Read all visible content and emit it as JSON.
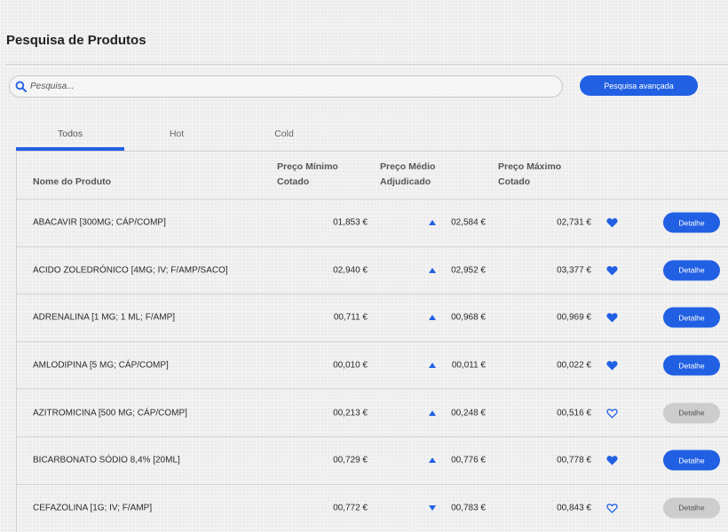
{
  "page": {
    "title": "Pesquisa de Produtos"
  },
  "search": {
    "placeholder": "Pesquisa...",
    "value": "",
    "advanced_label": "Pesquisa avançada"
  },
  "tabs": [
    {
      "label": "Todos",
      "active": true
    },
    {
      "label": "Hot",
      "active": false
    },
    {
      "label": "Cold",
      "active": false
    }
  ],
  "table": {
    "columns": {
      "name": "Nome do Produto",
      "min": "Preço Mínimo Cotado",
      "avg": "Preço Médio Adjudicado",
      "max": "Preço Máximo Cotado"
    },
    "rows": [
      {
        "name": "ABACAVIR [300MG; CÁP/COMP]",
        "min": "01,853 €",
        "trend": "up",
        "avg": "02,584 €",
        "max": "02,731 €",
        "favorite": true,
        "action": "Detalhe",
        "action_enabled": true
      },
      {
        "name": "ACIDO ZOLEDRÓNICO [4MG; IV; F/AMP/SACO]",
        "min": "02,940 €",
        "trend": "up",
        "avg": "02,952 €",
        "max": "03,377 €",
        "favorite": true,
        "action": "Detalhe",
        "action_enabled": true
      },
      {
        "name": "ADRENALINA [1 MG; 1 ML; F/AMP]",
        "min": "00,711 €",
        "trend": "up",
        "avg": "00,968 €",
        "max": "00,969 €",
        "favorite": true,
        "action": "Detalhe",
        "action_enabled": true
      },
      {
        "name": "AMLODIPINA [5 MG; CÁP/COMP]",
        "min": "00,010 €",
        "trend": "up",
        "avg": "00,011 €",
        "max": "00,022 €",
        "favorite": true,
        "action": "Detalhe",
        "action_enabled": true
      },
      {
        "name": "AZITROMICINA [500 MG; CÁP/COMP]",
        "min": "00,213 €",
        "trend": "up",
        "avg": "00,248 €",
        "max": "00,516 €",
        "favorite": false,
        "action": "Detalhe",
        "action_enabled": false
      },
      {
        "name": "BICARBONATO SÓDIO 8,4% [20ML]",
        "min": "00,729 €",
        "trend": "up",
        "avg": "00,776 €",
        "max": "00,778 €",
        "favorite": true,
        "action": "Detalhe",
        "action_enabled": true
      },
      {
        "name": "CEFAZOLINA [1G; IV; F/AMP]",
        "min": "00,772 €",
        "trend": "down",
        "avg": "00,783 €",
        "max": "00,843 €",
        "favorite": false,
        "action": "Detalhe",
        "action_enabled": false
      }
    ]
  },
  "colors": {
    "accent": "#2160e3",
    "disabled_button": "#cdcdcd"
  },
  "icons": {
    "search": "search-icon",
    "trend_up": "triangle-up-icon",
    "trend_down": "triangle-down-icon",
    "favorite": "heart-icon"
  }
}
